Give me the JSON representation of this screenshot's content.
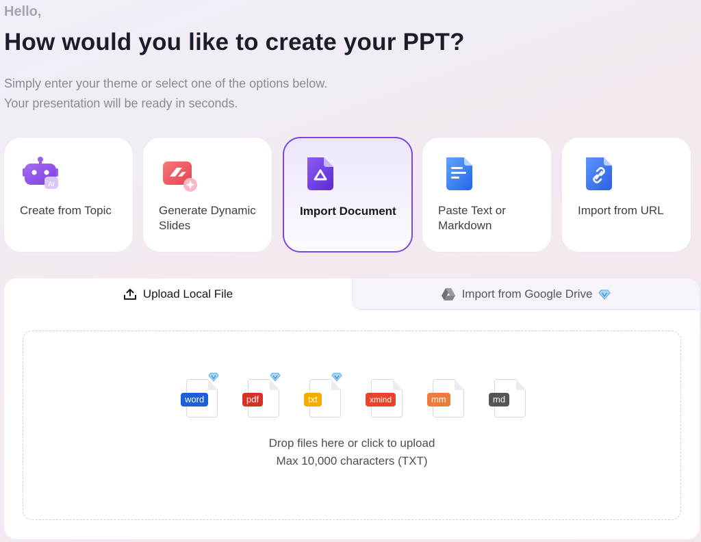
{
  "greeting": "Hello,",
  "headline": "How would you like to create your PPT?",
  "subtitle": [
    "Simply enter your theme or select one of the options below.",
    "Your presentation will be ready in seconds."
  ],
  "options": [
    {
      "label": "Create from Topic",
      "icon": "robot-ai-icon"
    },
    {
      "label": "Generate Dynamic Slides",
      "icon": "dynamic-slides-icon"
    },
    {
      "label": "Import Document",
      "icon": "document-drive-icon",
      "selected": true
    },
    {
      "label": "Paste Text or Markdown",
      "icon": "text-document-icon"
    },
    {
      "label": "Import from URL",
      "icon": "link-document-icon"
    }
  ],
  "tabs": {
    "local": "Upload Local File",
    "drive": "Import from Google Drive"
  },
  "file_types": [
    {
      "label": "word",
      "color": "#1b5fd9",
      "premium": true
    },
    {
      "label": "pdf",
      "color": "#d93025",
      "premium": true
    },
    {
      "label": "txt",
      "color": "#f5ac00",
      "premium": true
    },
    {
      "label": "xmind",
      "color": "#e8442c",
      "premium": false
    },
    {
      "label": "mm",
      "color": "#f07a3a",
      "premium": false
    },
    {
      "label": "md",
      "color": "#555555",
      "premium": false
    }
  ],
  "dropzone": {
    "primary": "Drop files here or click to upload",
    "secondary": "Max 10,000 characters (TXT)"
  },
  "colors": {
    "accent": "#7a45e6",
    "premium_gem": "#6fb8ef"
  }
}
